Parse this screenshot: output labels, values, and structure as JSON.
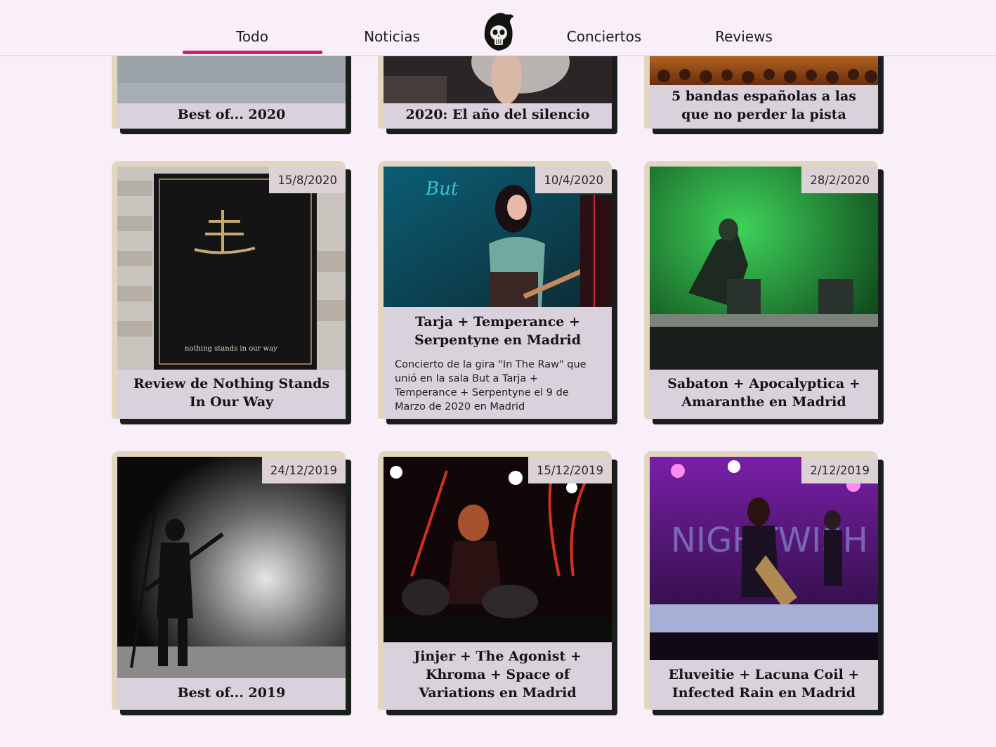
{
  "nav": {
    "items": [
      "Todo",
      "Noticias",
      "Conciertos",
      "Reviews"
    ],
    "active": "Todo",
    "accent": "#cc1f6a"
  },
  "logo": {
    "icon": "grim-reaper-skull-icon"
  },
  "cards": [
    {
      "title": "Best of... 2020"
    },
    {
      "title": "2020: El año del silencio"
    },
    {
      "title": "5 bandas españolas a las que no perder la pista"
    },
    {
      "date": "15/8/2020",
      "title": "Review de Nothing Stands In Our Way"
    },
    {
      "date": "10/4/2020",
      "title": "Tarja + Temperance + Serpentyne en Madrid",
      "excerpt": "Concierto de la gira \"In The Raw\" que unió en la sala But a Tarja + Temperance + Serpentyne el 9 de Marzo de 2020 en Madrid"
    },
    {
      "date": "28/2/2020",
      "title": "Sabaton + Apocalyptica + Amaranthe en Madrid"
    },
    {
      "date": "24/12/2019",
      "title": "Best of... 2019"
    },
    {
      "date": "15/12/2019",
      "title": "Jinjer + The Agonist + Khroma + Space of Variations en Madrid"
    },
    {
      "date": "2/12/2019",
      "title": "Eluveitie + Lacuna Coil + Infected Rain en Madrid"
    }
  ]
}
